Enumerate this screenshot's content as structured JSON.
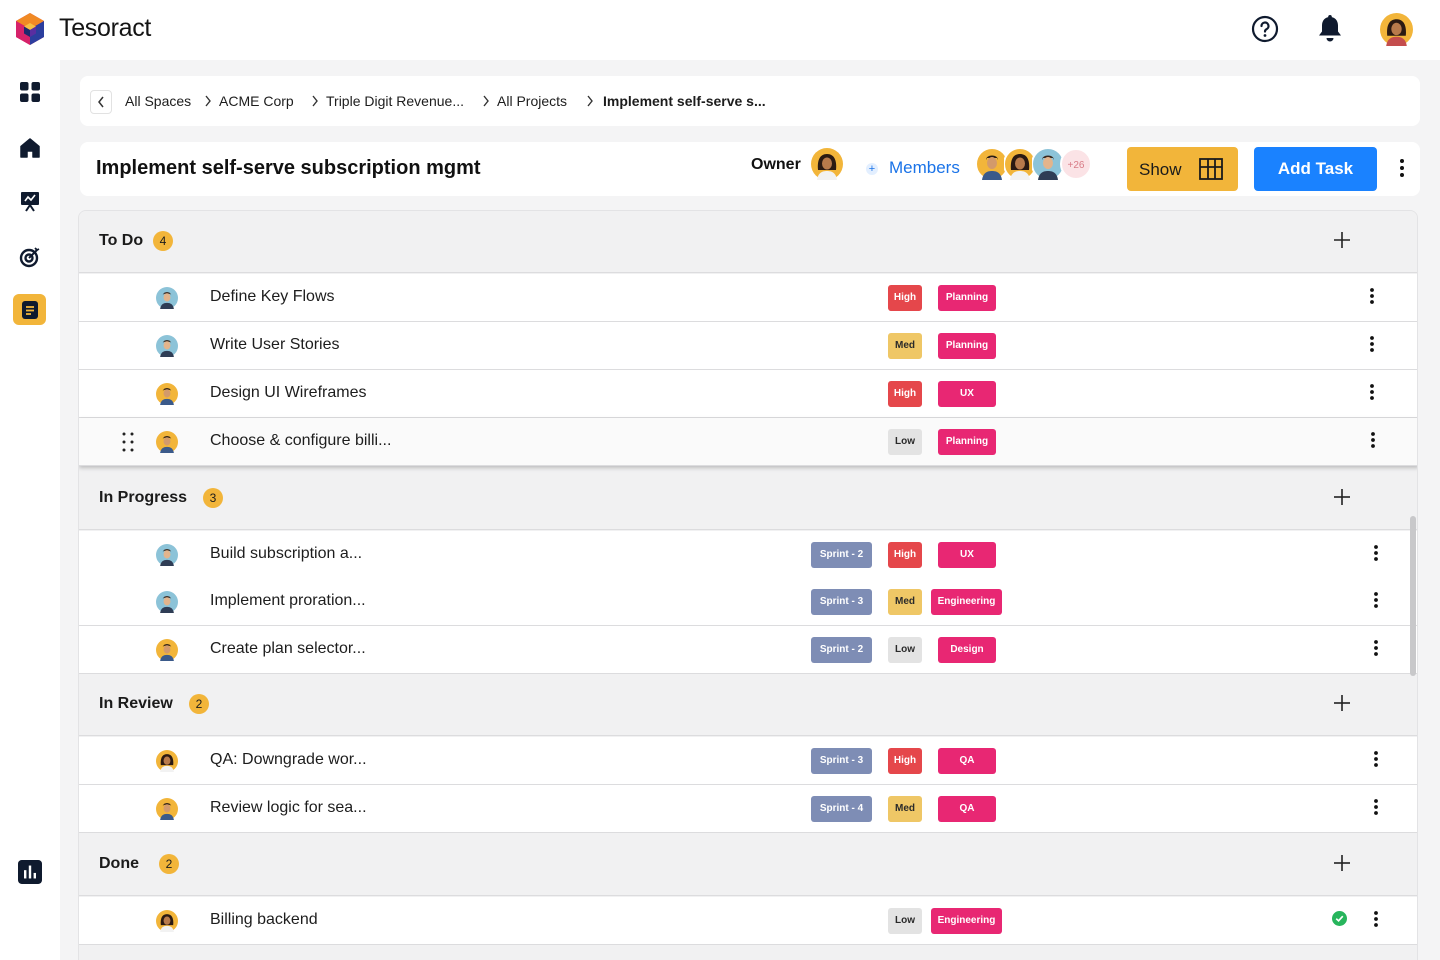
{
  "app": {
    "brand": "Tesoract",
    "logo_icon": "tesoract-cube-logo",
    "colors": {
      "accent": "#f2b53a",
      "primary": "#1a82ff",
      "label": "#e82773",
      "high": "#e5474b",
      "med": "#efc766",
      "sprint": "#7e8db5"
    }
  },
  "topbar": {
    "help_icon": "help-circle-icon",
    "bell_icon": "bell-icon",
    "avatar_icon": "user-avatar"
  },
  "sidebar": {
    "items": [
      {
        "name": "dashboard",
        "icon": "grid-icon"
      },
      {
        "name": "home",
        "icon": "home-icon"
      },
      {
        "name": "presentation",
        "icon": "presentation-icon"
      },
      {
        "name": "goals",
        "icon": "target-icon"
      },
      {
        "name": "documents",
        "icon": "document-icon",
        "active": true
      },
      {
        "name": "reports",
        "icon": "bar-chart-icon"
      }
    ]
  },
  "breadcrumb": [
    "All Spaces",
    "ACME Corp",
    "Triple Digit Revenue...",
    "All Projects",
    "Implement self-serve s..."
  ],
  "header": {
    "title": "Implement self-serve subscription mgmt",
    "owner_label": "Owner",
    "members_plus": "+",
    "members_label": "Members",
    "more_members": "+26",
    "show_label": "Show",
    "add_task_label": "Add Task"
  },
  "sections": [
    {
      "title": "To Do",
      "count": "4",
      "tasks": [
        {
          "title": "Define Key Flows",
          "priority": "High",
          "label": "Planning"
        },
        {
          "title": "Write User Stories",
          "priority": "Med",
          "label": "Planning"
        },
        {
          "title": "Design UI Wireframes",
          "priority": "High",
          "label": "UX"
        },
        {
          "title": "Choose & configure billi...",
          "priority": "Low",
          "label": "Planning"
        }
      ]
    },
    {
      "title": "In Progress",
      "count": "3",
      "tasks": [
        {
          "title": "Build subscription a...",
          "sprint": "Sprint - 2",
          "priority": "High",
          "label": "UX"
        },
        {
          "title": "Implement proration...",
          "sprint": "Sprint - 3",
          "priority": "Med",
          "label": "Engineering"
        },
        {
          "title": "Create plan selector...",
          "sprint": "Sprint - 2",
          "priority": "Low",
          "label": "Design"
        }
      ]
    },
    {
      "title": "In Review",
      "count": "2",
      "tasks": [
        {
          "title": "QA: Downgrade wor...",
          "sprint": "Sprint - 3",
          "priority": "High",
          "label": "QA"
        },
        {
          "title": "Review logic for sea...",
          "sprint": "Sprint - 4",
          "priority": "Med",
          "label": "QA"
        }
      ]
    },
    {
      "title": "Done",
      "count": "2",
      "tasks": [
        {
          "title": "Billing backend",
          "priority": "Low",
          "label": "Engineering",
          "completed": true
        }
      ]
    }
  ]
}
